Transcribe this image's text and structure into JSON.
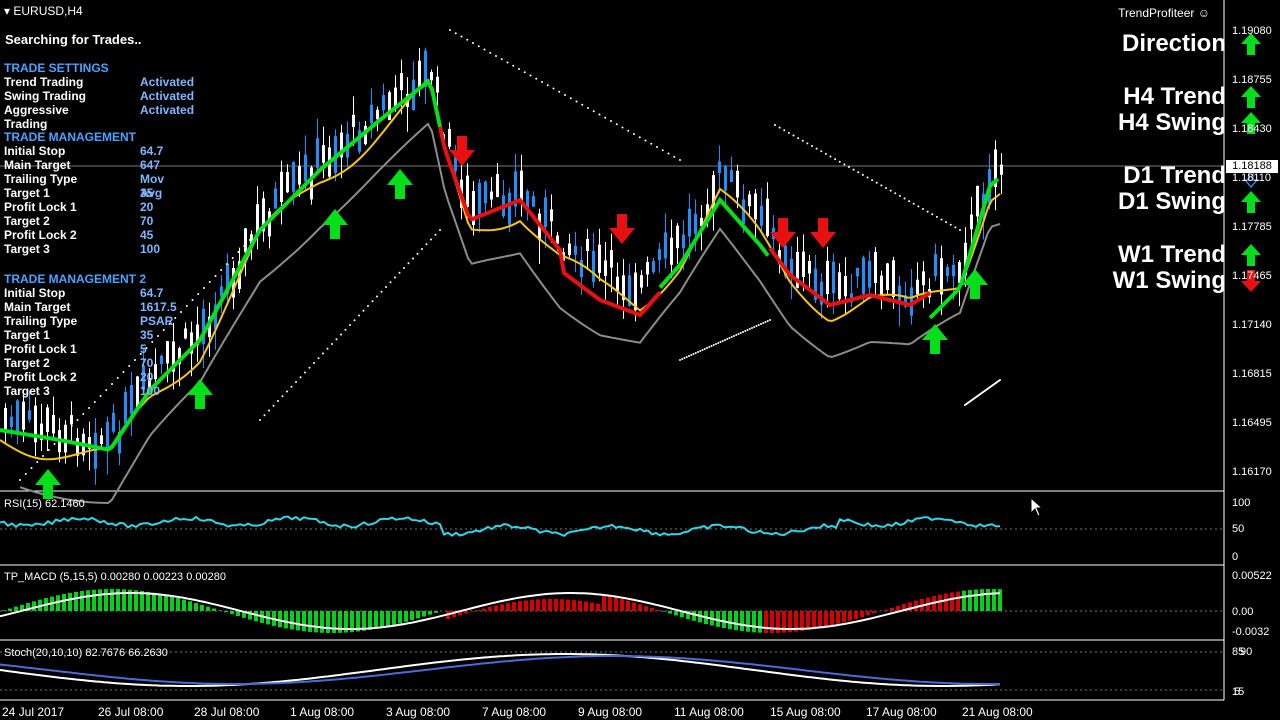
{
  "symbol": "EURUSD,H4",
  "indicator_name": "TrendProfiteer",
  "status": "Searching for Trades..",
  "trade_settings": {
    "title": "TRADE SETTINGS",
    "rows": [
      {
        "label": "Trend Trading",
        "value": "Activated"
      },
      {
        "label": "Swing Trading",
        "value": "Activated"
      },
      {
        "label": "Aggressive Trading",
        "value": "Activated"
      }
    ]
  },
  "trade_management_1": {
    "title": "TRADE MANAGEMENT",
    "rows": [
      {
        "label": "Initial Stop",
        "value": "64.7"
      },
      {
        "label": "Main Target",
        "value": "647"
      },
      {
        "label": "Trailing Type",
        "value": "Mov Avg"
      },
      {
        "label": "Target 1",
        "value": "35"
      },
      {
        "label": "Profit Lock 1",
        "value": "20"
      },
      {
        "label": "Target 2",
        "value": "70"
      },
      {
        "label": "Profit Lock 2",
        "value": "45"
      },
      {
        "label": "Target 3",
        "value": "100"
      }
    ]
  },
  "trade_management_2": {
    "title": "TRADE MANAGEMENT 2",
    "rows": [
      {
        "label": "Initial Stop",
        "value": "64.7"
      },
      {
        "label": "Main Target",
        "value": "1617.5"
      },
      {
        "label": "Trailing Type",
        "value": "PSAR"
      },
      {
        "label": "Target 1",
        "value": "35"
      },
      {
        "label": "Profit Lock 1",
        "value": "5"
      },
      {
        "label": "Target 2",
        "value": "70"
      },
      {
        "label": "Profit Lock 2",
        "value": "20"
      },
      {
        "label": "Target 3",
        "value": "100"
      }
    ]
  },
  "signals": [
    {
      "label": "Direction",
      "state": "up"
    },
    {
      "label": "H4 Trend",
      "state": "up"
    },
    {
      "label": "H4 Swing",
      "state": "up"
    },
    {
      "label": "D1 Trend",
      "state": "neutral"
    },
    {
      "label": "D1 Swing",
      "state": "up"
    },
    {
      "label": "W1 Trend",
      "state": "up"
    },
    {
      "label": "W1 Swing",
      "state": "down"
    }
  ],
  "price_axis": [
    "1.19080",
    "1.18755",
    "1.18430",
    "1.18110",
    "1.17785",
    "1.17465",
    "1.17140",
    "1.16815",
    "1.16495",
    "1.16170"
  ],
  "current_price": "1.18188",
  "time_axis": [
    "24 Jul 2017",
    "26 Jul 08:00",
    "28 Jul 08:00",
    "1 Aug 08:00",
    "3 Aug 08:00",
    "7 Aug 08:00",
    "9 Aug 08:00",
    "11 Aug 08:00",
    "15 Aug 08:00",
    "17 Aug 08:00",
    "21 Aug 08:00"
  ],
  "rsi": {
    "label": "RSI(15) 62.1460",
    "levels": [
      "100",
      "50",
      "0"
    ]
  },
  "macd": {
    "label": "TP_MACD (5,15,5) 0.00280 0.00223 0.00280",
    "levels": [
      "0.00522",
      "0.00",
      "-0.0032"
    ]
  },
  "stoch": {
    "label": "Stoch(20,10,10) 82.7676 66.2630",
    "levels": [
      "85",
      "90",
      "15",
      "5"
    ]
  },
  "colors": {
    "bg": "#000000",
    "candle": "#3a7bd5",
    "bull": "#1f8fff",
    "green": "#00e01a",
    "red": "#e81010",
    "yellow": "#f5c518",
    "gray": "#8c8c8c",
    "rsi": "#2fd6e6",
    "macd_up": "#00d21c",
    "macd_down": "#d40000",
    "stoch_main": "#ffffff",
    "stoch_sig": "#4a6bd6"
  }
}
